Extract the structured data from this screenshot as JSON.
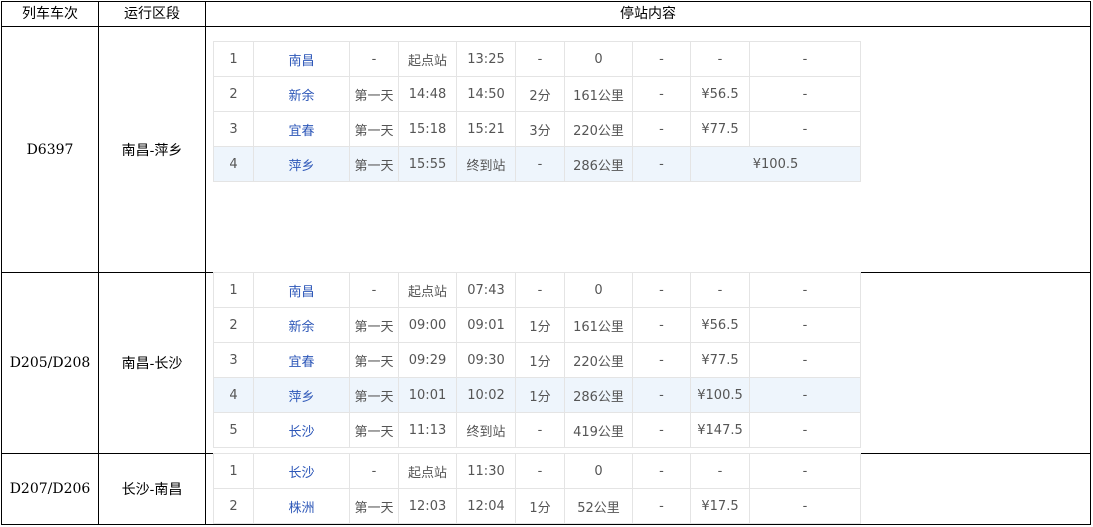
{
  "headers": {
    "train": "列车车次",
    "segment": "运行区段",
    "stops": "停站内容"
  },
  "trains": [
    {
      "train_no": "D6397",
      "segment": "南昌-萍乡",
      "stops": [
        [
          "1",
          "南昌",
          "-",
          "起点站",
          "13:25",
          "-",
          "0",
          "-",
          "-",
          "-"
        ],
        [
          "2",
          "新余",
          "第一天",
          "14:48",
          "14:50",
          "2分",
          "161公里",
          "-",
          "¥56.5",
          "-"
        ],
        [
          "3",
          "宜春",
          "第一天",
          "15:18",
          "15:21",
          "3分",
          "220公里",
          "-",
          "¥77.5",
          "-"
        ],
        [
          "4",
          "萍乡",
          "第一天",
          "15:55",
          "终到站",
          "-",
          "286公里",
          "-",
          "¥100.5"
        ]
      ]
    },
    {
      "train_no": "D205/D208",
      "segment": "南昌-长沙",
      "stops": [
        [
          "1",
          "南昌",
          "-",
          "起点站",
          "07:43",
          "-",
          "0",
          "-",
          "-",
          "-"
        ],
        [
          "2",
          "新余",
          "第一天",
          "09:00",
          "09:01",
          "1分",
          "161公里",
          "-",
          "¥56.5",
          "-"
        ],
        [
          "3",
          "宜春",
          "第一天",
          "09:29",
          "09:30",
          "1分",
          "220公里",
          "-",
          "¥77.5",
          "-"
        ],
        [
          "4",
          "萍乡",
          "第一天",
          "10:01",
          "10:02",
          "1分",
          "286公里",
          "-",
          "¥100.5",
          "-"
        ],
        [
          "5",
          "长沙",
          "第一天",
          "11:13",
          "终到站",
          "-",
          "419公里",
          "-",
          "¥147.5",
          "-"
        ]
      ]
    },
    {
      "train_no": "D207/D206",
      "segment": "长沙-南昌",
      "stops": [
        [
          "1",
          "长沙",
          "-",
          "起点站",
          "11:30",
          "-",
          "0",
          "-",
          "-",
          "-"
        ],
        [
          "2",
          "株洲",
          "第一天",
          "12:03",
          "12:04",
          "1分",
          "52公里",
          "-",
          "¥17.5",
          "-"
        ]
      ]
    }
  ]
}
